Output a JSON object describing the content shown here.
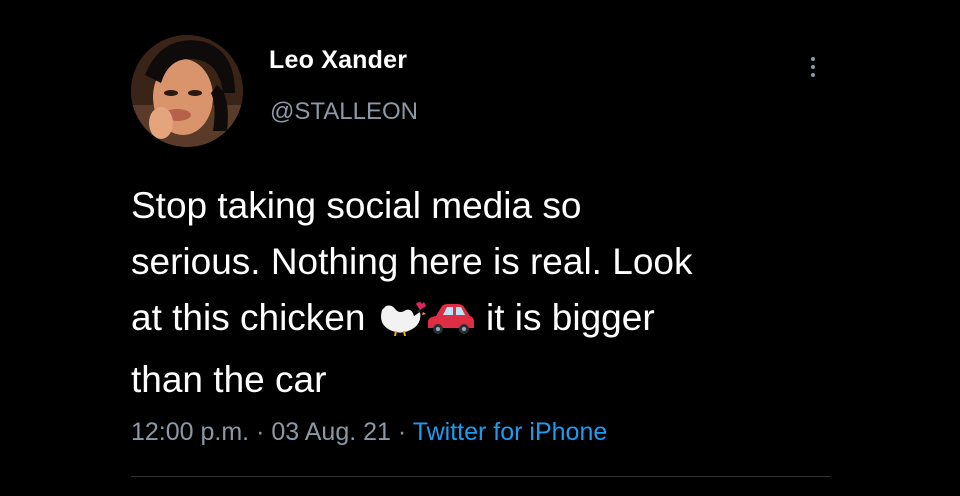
{
  "user": {
    "display_name": "Leo Xander",
    "handle": "@STALLEON"
  },
  "tweet": {
    "line1": "Stop taking social media so",
    "line2": "serious. Nothing here is real. Look",
    "line3_before": "at this chicken",
    "line3_after": "it is bigger",
    "line4": "than the car",
    "emojis": [
      "chicken-icon",
      "car-icon"
    ]
  },
  "meta": {
    "time": "12:00 p.m.",
    "date": "03 Aug. 21",
    "source": "Twitter for iPhone",
    "separator": "·"
  },
  "icons": {
    "more": "more-vertical-icon"
  },
  "colors": {
    "background": "#000000",
    "text": "#ffffff",
    "secondary": "#8b98a5",
    "link": "#1d9bf0"
  }
}
